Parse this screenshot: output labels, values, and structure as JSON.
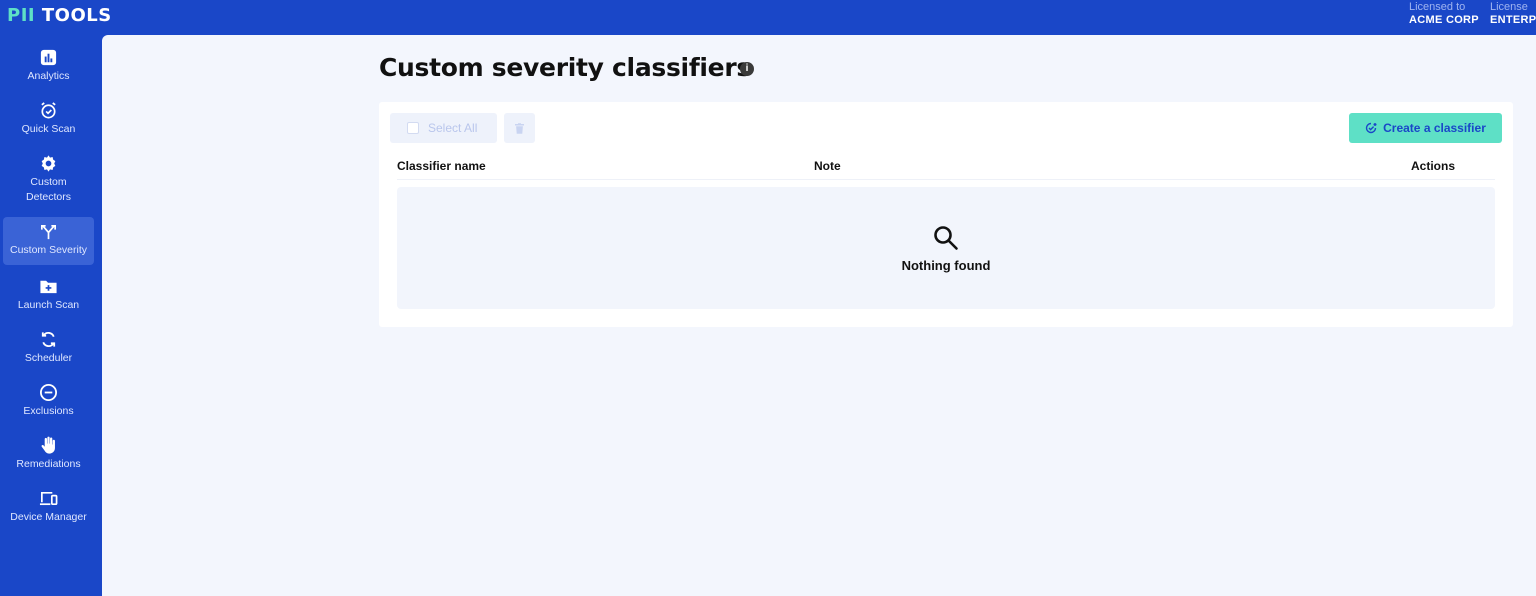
{
  "app": {
    "logo_prefix": "PII",
    "logo_suffix": " TOOLS",
    "license": [
      {
        "label": "Licensed to",
        "value": "ACME CORP"
      },
      {
        "label": "License",
        "value": "ENTERP"
      }
    ]
  },
  "sidebar": {
    "items": [
      {
        "label": "Analytics",
        "icon": "analytics-icon"
      },
      {
        "label": "Quick Scan",
        "icon": "alarm-clock-icon"
      },
      {
        "label": "Custom Detectors",
        "icon": "gear-icon"
      },
      {
        "label": "Custom Severity",
        "icon": "branch-arrows-icon",
        "active": true
      },
      {
        "label": "Launch Scan",
        "icon": "folder-plus-icon"
      },
      {
        "label": "Scheduler",
        "icon": "refresh-icon"
      },
      {
        "label": "Exclusions",
        "icon": "minus-circle-icon"
      },
      {
        "label": "Remediations",
        "icon": "hand-icon"
      },
      {
        "label": "Device Manager",
        "icon": "devices-icon"
      }
    ]
  },
  "page": {
    "title": "Custom severity classifiers",
    "info_glyph": "i"
  },
  "toolbar": {
    "select_all_label": "Select All",
    "create_label": "Create a classifier"
  },
  "table": {
    "columns": [
      "Classifier name",
      "Note",
      "Actions"
    ],
    "empty_message": "Nothing found"
  },
  "colors": {
    "brand_blue": "#1a47c8",
    "accent_teal": "#5ee0c6",
    "panel_bg": "#f3f6fd"
  }
}
